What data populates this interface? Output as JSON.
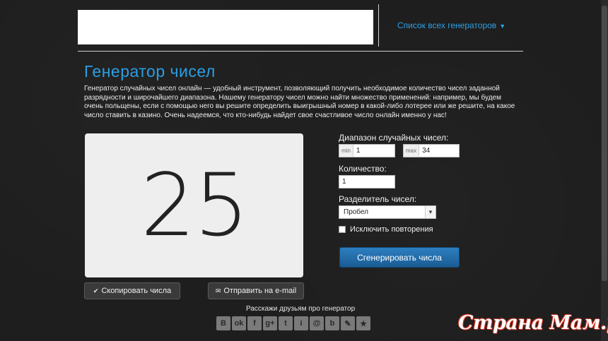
{
  "header": {
    "generators_link": "Список всех генераторов"
  },
  "page": {
    "title": "Генератор чисел",
    "description": "Генератор случайных чисел онлайн — удобный инструмент, позволяющий получить необходимое количество чисел заданной разрядности и широчайшего диапазона. Нашему генератору чисел можно найти множество применений: например, мы будем очень польщены, если с помощью него вы решите определить выигрышный номер в какой-либо лотерее или же решите, на какое число ставить в казино. Очень надеемся, что кто-нибудь найдет свое счастливое число онлайн именно у нас!"
  },
  "result": {
    "number": "25"
  },
  "buttons": {
    "copy": "Скопировать числа",
    "email": "Отправить на e-mail",
    "generate": "Сгенерировать числа"
  },
  "share": {
    "label": "Расскажи друзьям про генератор",
    "icons": [
      {
        "name": "vk-icon",
        "glyph": "B"
      },
      {
        "name": "odnoklassniki-icon",
        "glyph": "ok"
      },
      {
        "name": "facebook-icon",
        "glyph": "f"
      },
      {
        "name": "google-plus-icon",
        "glyph": "g+"
      },
      {
        "name": "twitter-icon",
        "glyph": "t"
      },
      {
        "name": "moimir-icon",
        "glyph": "i"
      },
      {
        "name": "mailru-icon",
        "glyph": "@"
      },
      {
        "name": "blogger-icon",
        "glyph": "b"
      },
      {
        "name": "livejournal-icon",
        "glyph": "✎"
      },
      {
        "name": "bookmark-star-icon",
        "glyph": "★"
      }
    ]
  },
  "form": {
    "range_label": "Диапазон случайных чисел:",
    "min_prefix": "min",
    "min_value": "1",
    "max_prefix": "max",
    "max_value": "34",
    "count_label": "Количество:",
    "count_value": "1",
    "separator_label": "Разделитель чисел:",
    "separator_value": "Пробел",
    "exclude_repeats_label": "Исключить повторения"
  },
  "watermark": "Страна Мам.ру",
  "colors": {
    "accent": "#2a9fe4",
    "background": "#1e1e1e",
    "generate_button": "#2c7fc0"
  }
}
